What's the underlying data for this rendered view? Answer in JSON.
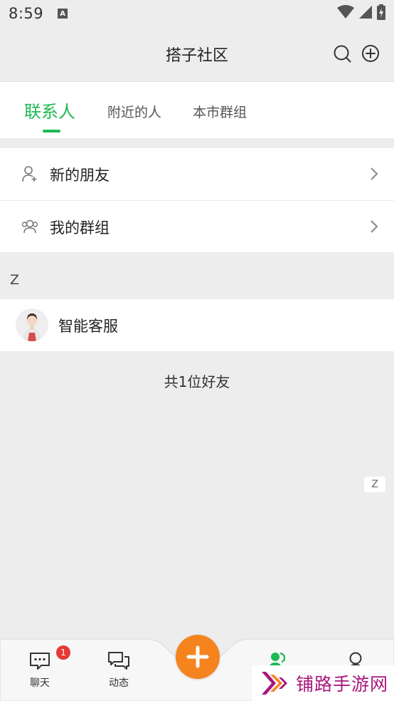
{
  "status_bar": {
    "time": "8:59",
    "notification_letter": "A"
  },
  "header": {
    "title": "搭子社区"
  },
  "tabs": [
    {
      "label": "联系人",
      "active": true
    },
    {
      "label": "附近的人",
      "active": false
    },
    {
      "label": "本市群组",
      "active": false
    }
  ],
  "menu": [
    {
      "label": "新的朋友",
      "icon": "add-person-icon"
    },
    {
      "label": "我的群组",
      "icon": "group-icon"
    }
  ],
  "section": {
    "letter": "Z"
  },
  "contact": {
    "name": "智能客服"
  },
  "friend_count": "共1位好友",
  "index_bar": {
    "letter": "Z"
  },
  "bottom_nav": {
    "chat_label": "聊天",
    "chat_badge": "1",
    "feed_label": "动态",
    "accent_color": "#1db954",
    "fab_color": "#f5841f"
  },
  "watermark": {
    "text": "铺路手游网"
  }
}
